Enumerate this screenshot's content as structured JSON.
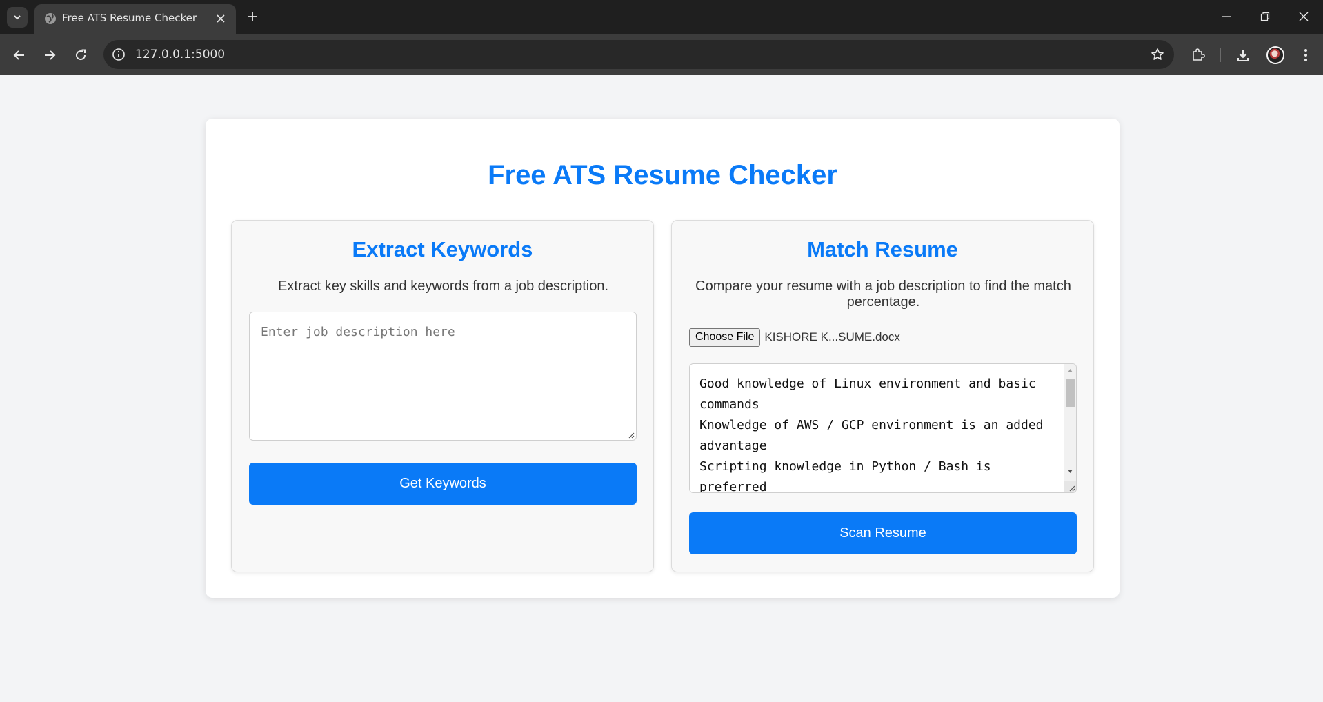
{
  "browser": {
    "tab_title": "Free ATS Resume Checker",
    "url": "127.0.0.1:5000"
  },
  "page": {
    "title": "Free ATS Resume Checker"
  },
  "extract": {
    "title": "Extract Keywords",
    "description": "Extract key skills and keywords from a job description.",
    "placeholder": "Enter job description here",
    "button": "Get Keywords"
  },
  "match": {
    "title": "Match Resume",
    "description": "Compare your resume with a job description to find the match percentage.",
    "choose_file_label": "Choose File",
    "file_name": "KISHORE K...SUME.docx",
    "job_description_text": "Good knowledge of Linux environment and basic\ncommands\nKnowledge of AWS / GCP environment is an added\nadvantage\nScripting knowledge in Python / Bash is\npreferred",
    "button": "Scan Resume"
  },
  "colors": {
    "accent": "#0a7af7",
    "page_bg": "#f3f4f6",
    "panel_bg": "#f8f8f8"
  },
  "icons": [
    "tab-list-icon",
    "globe-icon",
    "close-icon",
    "plus-icon",
    "minimize-icon",
    "restore-icon",
    "back-icon",
    "forward-icon",
    "reload-icon",
    "site-info-icon",
    "star-icon",
    "extensions-icon",
    "download-icon",
    "avatar",
    "menu-icon"
  ]
}
